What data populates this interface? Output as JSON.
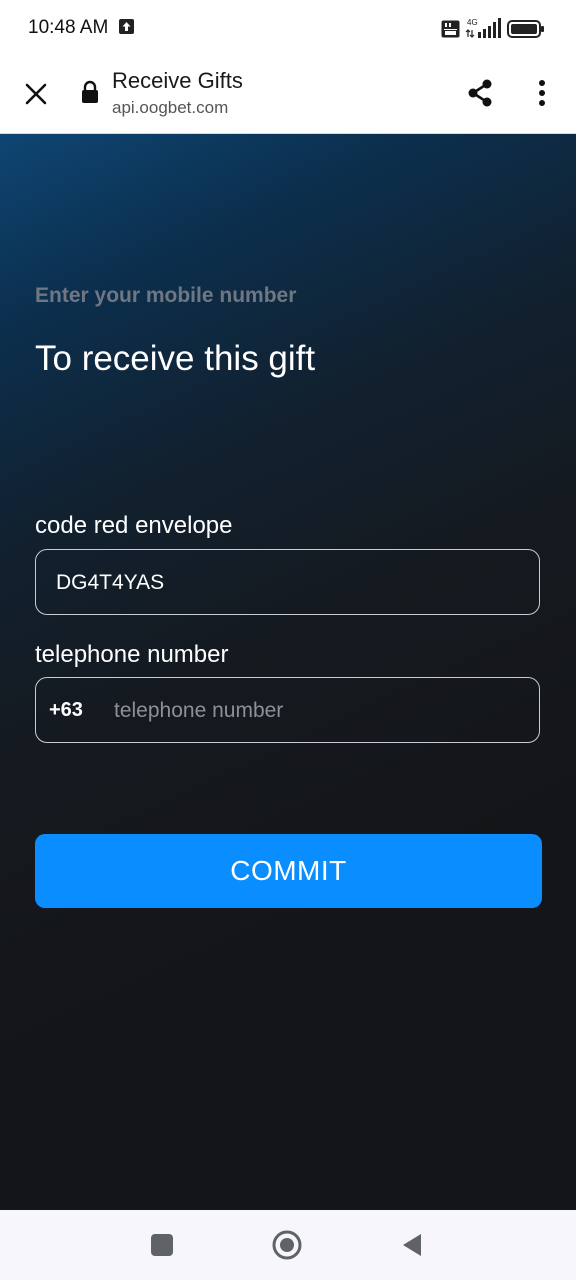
{
  "status_bar": {
    "time": "10:48 AM",
    "icons": [
      "upload-icon",
      "volte-icon",
      "signal-4g-icon",
      "battery-icon"
    ]
  },
  "browser": {
    "title": "Receive Gifts",
    "url": "api.oogbet.com",
    "icons": [
      "close-icon",
      "lock-icon",
      "share-icon",
      "more-vert-icon"
    ]
  },
  "form": {
    "subheading": "Enter your mobile number",
    "heading": "To receive this gift",
    "code": {
      "label": "code red envelope",
      "value": "DG4T4YAS"
    },
    "phone": {
      "label": "telephone number",
      "prefix": "+63",
      "placeholder": "telephone number",
      "value": ""
    },
    "commit_label": "COMMIT"
  },
  "nav_bar": {
    "icons": [
      "recents-icon",
      "home-icon",
      "back-icon"
    ]
  },
  "colors": {
    "accent": "#0a8dff",
    "page_background": "#141518",
    "subheading": "#6f7782"
  }
}
